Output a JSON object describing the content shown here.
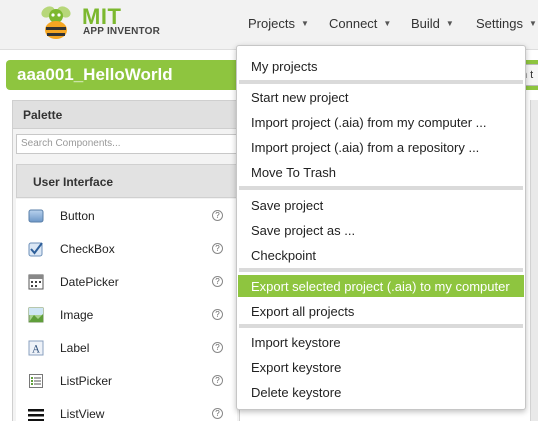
{
  "brand": {
    "title": "MIT",
    "subtitle": "APP INVENTOR"
  },
  "nav": [
    {
      "label": "Projects"
    },
    {
      "label": "Connect"
    },
    {
      "label": "Build"
    },
    {
      "label": "Settings"
    }
  ],
  "project": {
    "title": "aaa001_HelloWorld",
    "switch_label": "h t"
  },
  "palette": {
    "header": "Palette",
    "search_placeholder": "Search Components...",
    "category": "User Interface",
    "components": [
      {
        "label": "Button",
        "icon": "button-icon"
      },
      {
        "label": "CheckBox",
        "icon": "checkbox-icon"
      },
      {
        "label": "DatePicker",
        "icon": "datepicker-icon"
      },
      {
        "label": "Image",
        "icon": "image-icon"
      },
      {
        "label": "Label",
        "icon": "label-icon"
      },
      {
        "label": "ListPicker",
        "icon": "listpicker-icon"
      },
      {
        "label": "ListView",
        "icon": "listview-icon"
      }
    ],
    "help_glyph": "?"
  },
  "projects_menu": {
    "items": [
      {
        "label": "My projects"
      },
      {
        "label": "Start new project"
      },
      {
        "label": "Import project (.aia) from my computer ..."
      },
      {
        "label": "Import project (.aia) from a repository ..."
      },
      {
        "label": "Move To Trash"
      },
      {
        "label": "Save project"
      },
      {
        "label": "Save project as ..."
      },
      {
        "label": "Checkpoint"
      },
      {
        "label": "Export selected project (.aia) to my computer",
        "highlighted": true
      },
      {
        "label": "Export all projects"
      },
      {
        "label": "Import keystore"
      },
      {
        "label": "Export keystore"
      },
      {
        "label": "Delete keystore"
      }
    ]
  },
  "colors": {
    "accent": "#8ec53f",
    "brand_green": "#7cb82f"
  }
}
